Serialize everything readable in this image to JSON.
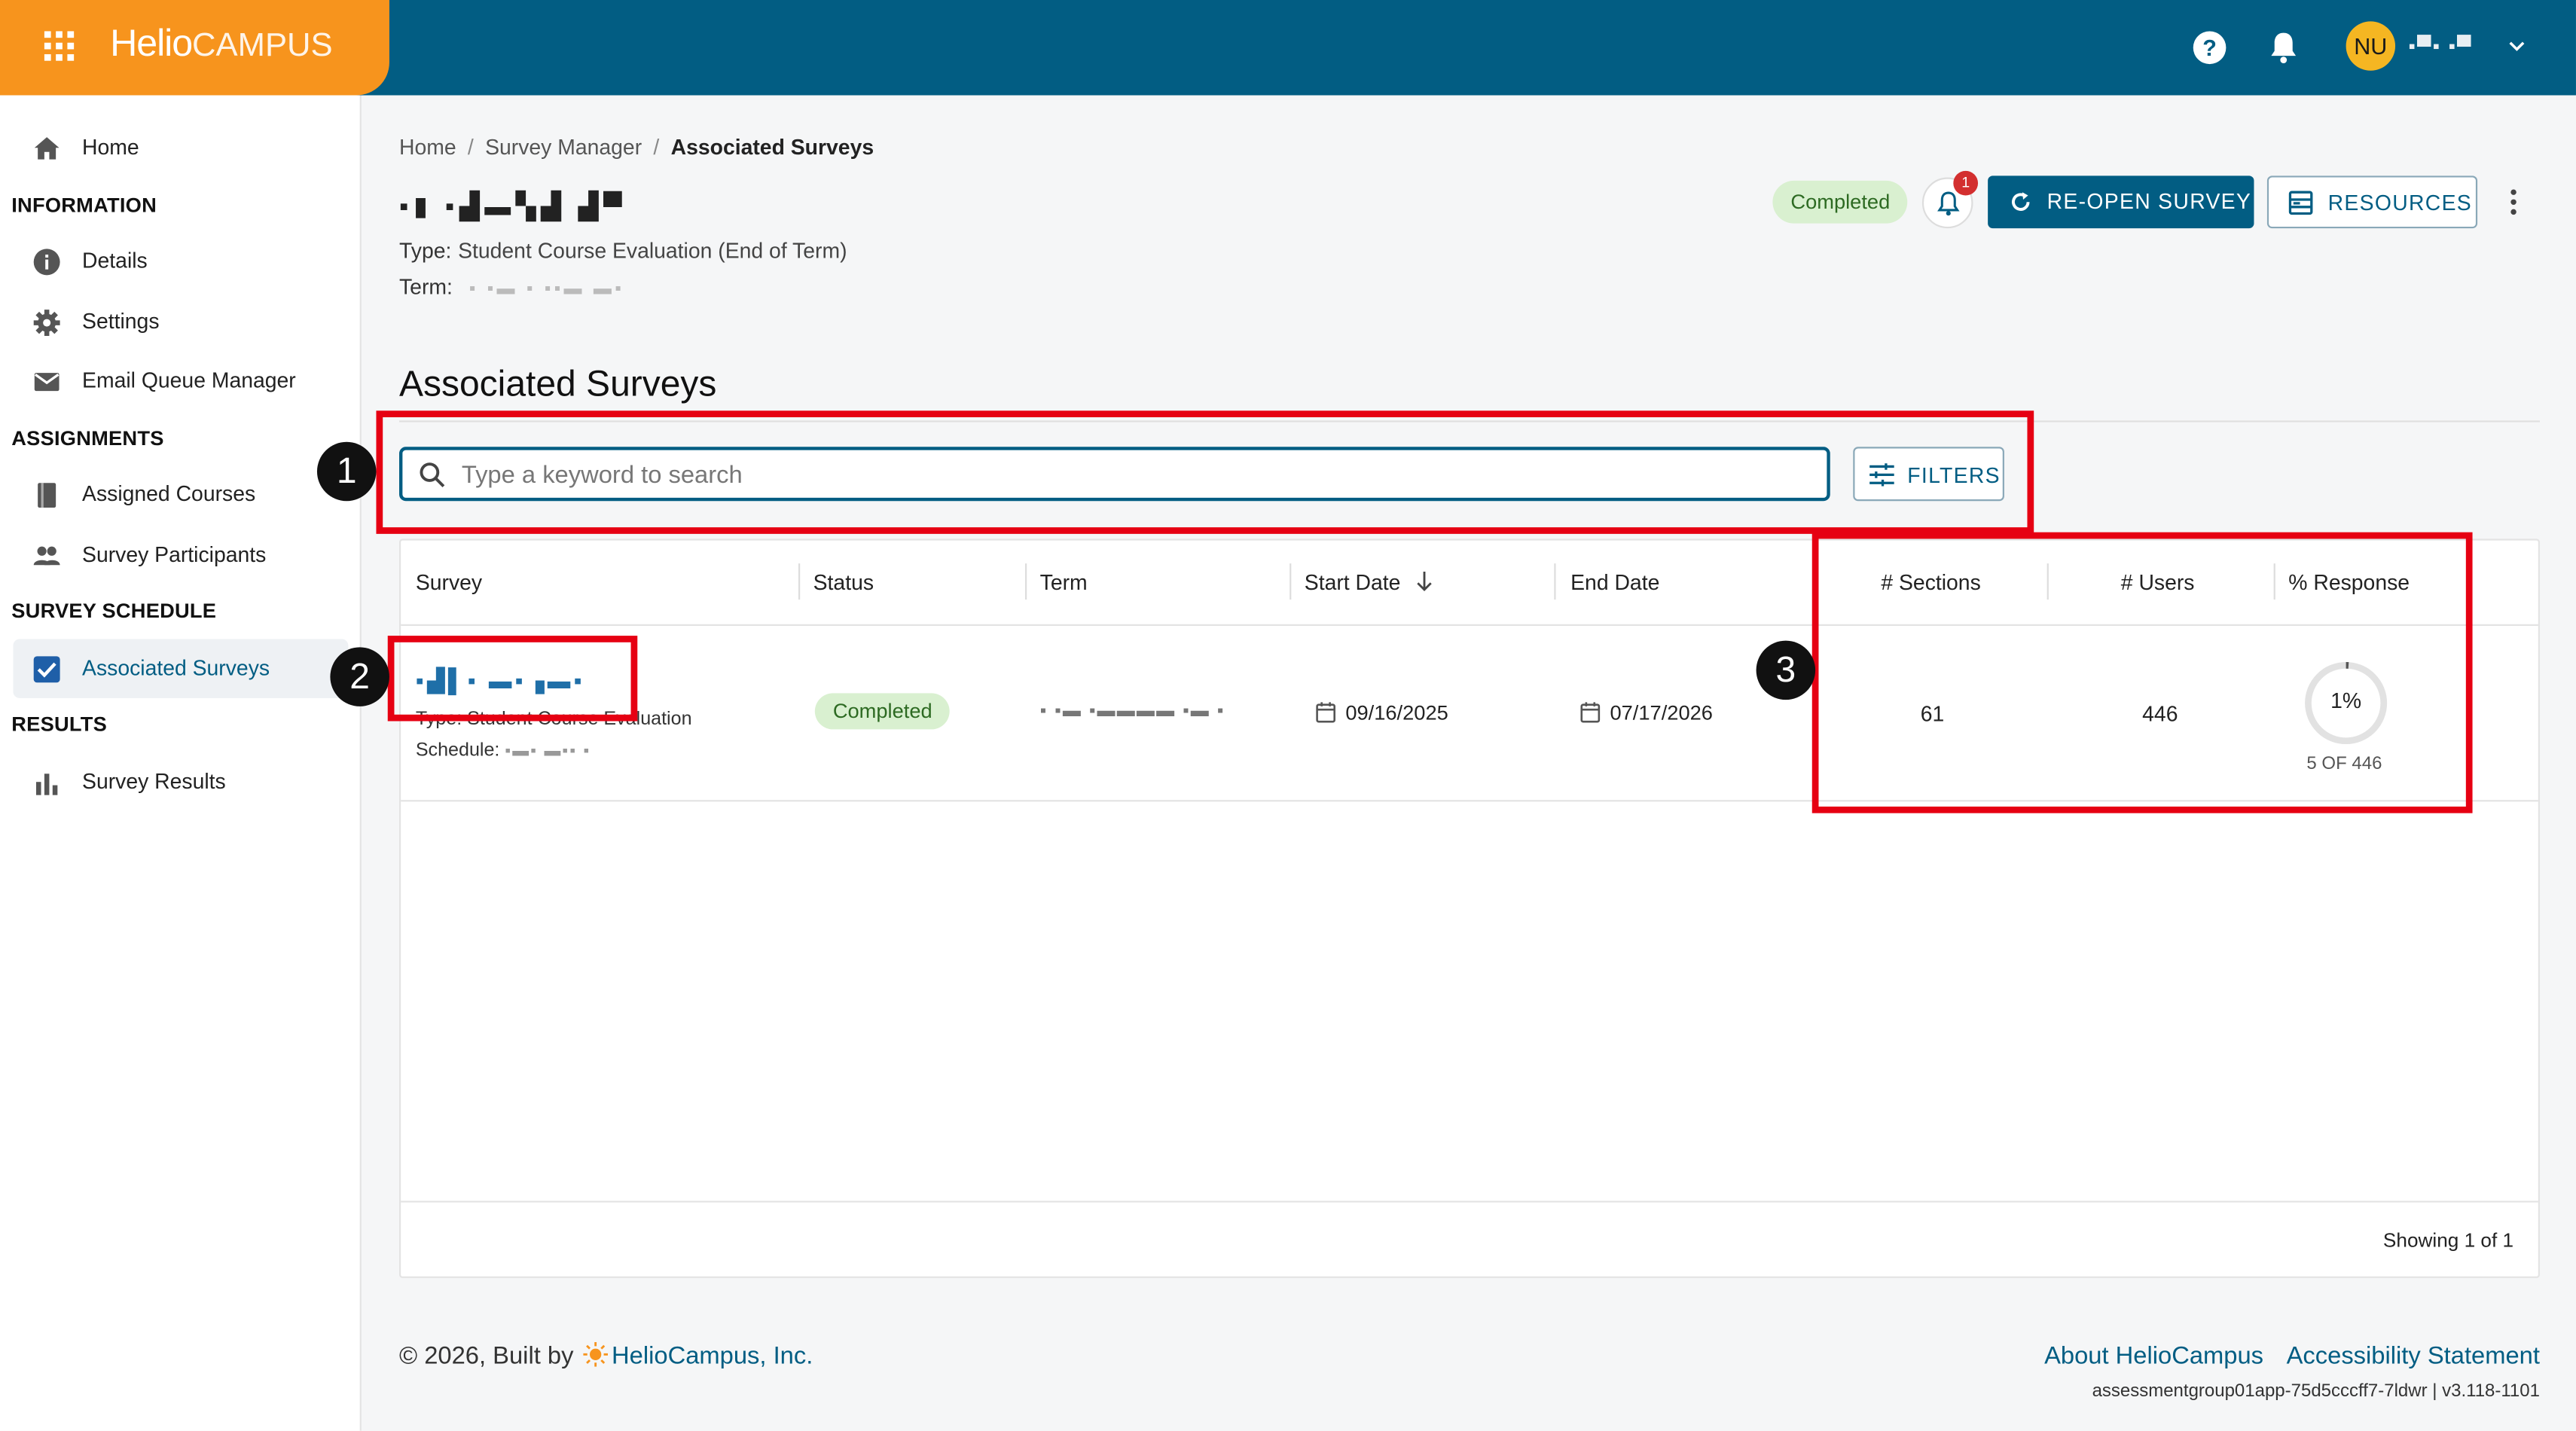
{
  "brand": {
    "name_a": "Helio",
    "name_b": "CAMPUS"
  },
  "topbar": {
    "avatar_initials": "NU",
    "user_name": "▪▀▪ ▪▀"
  },
  "sidebar": {
    "home": "Home",
    "sections": [
      {
        "heading": "INFORMATION",
        "items": [
          "Details",
          "Settings",
          "Email Queue Manager"
        ]
      },
      {
        "heading": "ASSIGNMENTS",
        "items": [
          "Assigned Courses",
          "Survey Participants"
        ]
      },
      {
        "heading": "SURVEY SCHEDULE",
        "items": [
          "Associated Surveys"
        ]
      },
      {
        "heading": "RESULTS",
        "items": [
          "Survey Results"
        ]
      }
    ],
    "active_item": "Associated Surveys"
  },
  "breadcrumb": {
    "items": [
      "Home",
      "Survey Manager",
      "Associated Surveys"
    ]
  },
  "survey": {
    "title_redacted": "▪▮ ▪▟▬▚▟ ▟▀",
    "type_label": "Type:",
    "type_value": "Student Course Evaluation (End of Term)",
    "term_label": "Term:",
    "term_value": "▪ ▪▬ ▪ ▪▪▬ ▬▪"
  },
  "header_actions": {
    "status": "Completed",
    "notification_count": "1",
    "reopen": "RE-OPEN SURVEY",
    "resources": "RESOURCES"
  },
  "section_title": "Associated Surveys",
  "search": {
    "placeholder": "Type a keyword to search",
    "value": ""
  },
  "filters_label": "FILTERS",
  "table": {
    "columns": [
      "Survey",
      "Status",
      "Term",
      "Start Date",
      "End Date",
      "# Sections",
      "# Users",
      "% Response"
    ],
    "sorted_column": "Start Date",
    "rows": [
      {
        "survey_name_redacted": "▪▟▌▪ ▬▪▗▬▪",
        "type_line": "Type:   Student Course Evaluation",
        "schedule_label": "Schedule:",
        "schedule_value": "▪▬▪ ▬▪▪ ▪",
        "status": "Completed",
        "term": "▪ ▪▬ ▪▬▬▬▬ ▪▬ ▪",
        "start_date": "09/16/2025",
        "end_date": "07/17/2026",
        "sections": "61",
        "users": "446",
        "response_pct": "1%",
        "response_fraction": 0.011,
        "response_detail": "5 OF 446"
      }
    ],
    "showing": "Showing 1 of 1"
  },
  "annotations": [
    "1",
    "2",
    "3"
  ],
  "footer": {
    "copyright_prefix": "© 2026, Built by",
    "company": "HelioCampus, Inc.",
    "links": [
      "About HelioCampus",
      "Accessibility Statement"
    ],
    "build": "assessmentgroup01app-75d5cccff7-7ldwr | v3.118-1101"
  },
  "colors": {
    "primary": "#025d83",
    "brand": "#f7941d",
    "annotation": "#e60012",
    "status_chip": "#d9f0d0"
  }
}
